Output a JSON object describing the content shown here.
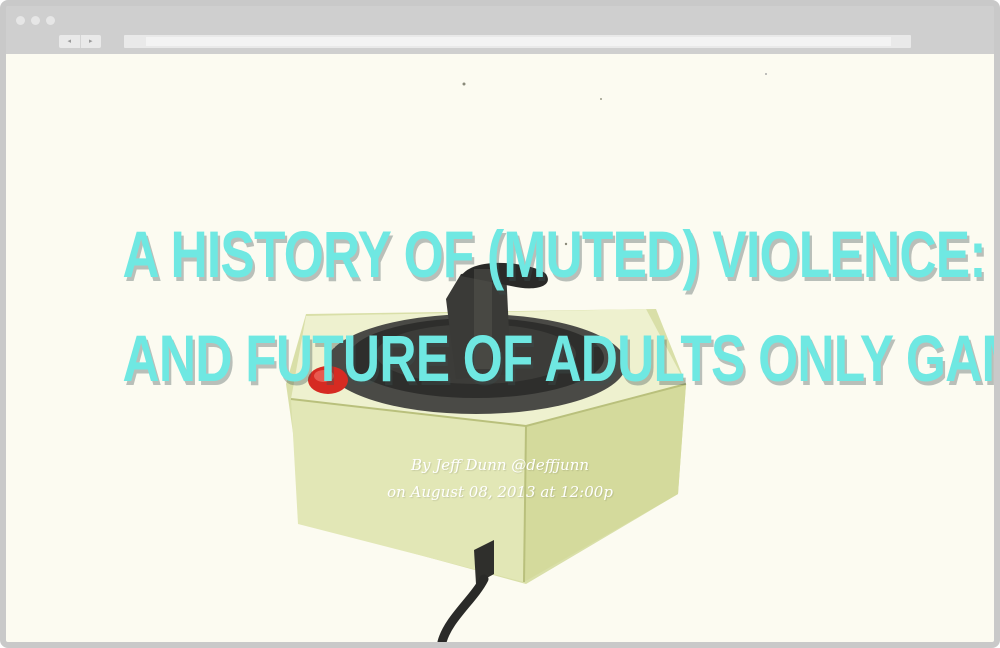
{
  "browser": {
    "back_glyph": "◂",
    "forward_glyph": "▸"
  },
  "article": {
    "title_line_1": "A HISTORY OF (MUTED) VIOLENCE: THE PRESENT",
    "title_line_2": "AND FUTURE OF ADULTS ONLY GAMES",
    "author_line": "By Jeff Dunn @deffjunn",
    "date_line": "on August 08, 2013 at 12:00p"
  },
  "colors": {
    "title": "#6fe8e2",
    "page_background": "#fcfbf1",
    "joystick_base": "#e9edc4",
    "fire_button": "#d62b22"
  },
  "hero_image": {
    "subject": "joystick-illustration-icon"
  }
}
